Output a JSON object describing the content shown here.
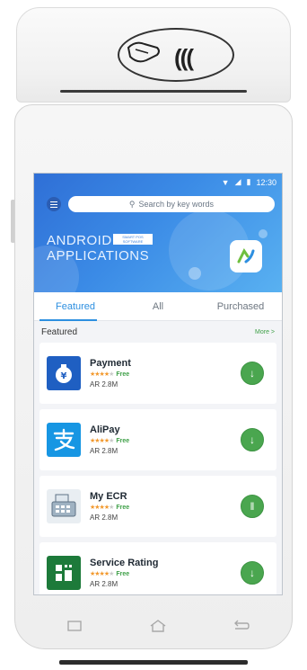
{
  "status_bar": {
    "time": "12:30"
  },
  "search": {
    "placeholder": "Search by key words"
  },
  "banner": {
    "title_line1": "ANDROID",
    "title_line2": "APPLICATIONS",
    "badge": "SMART POS SOFTWARE"
  },
  "tabs": [
    {
      "label": "Featured",
      "active": true
    },
    {
      "label": "All",
      "active": false
    },
    {
      "label": "Purchased",
      "active": false
    }
  ],
  "section": {
    "title": "Featured",
    "more_label": "More >"
  },
  "apps": [
    {
      "name": "Payment",
      "rating": 4,
      "price": "Free",
      "meta": "AR 2.8M",
      "icon": "payment-icon",
      "icon_color": "#1f5fc2"
    },
    {
      "name": "AliPay",
      "rating": 4,
      "price": "Free",
      "meta": "AR 2.8M",
      "icon": "alipay-icon",
      "icon_color": "#1796e3"
    },
    {
      "name": "My ECR",
      "rating": 4,
      "price": "Free",
      "meta": "AR 2.8M",
      "icon": "ecr-register-icon",
      "icon_color": "#8aa0b4"
    },
    {
      "name": "Service Rating",
      "rating": 4,
      "price": "Free",
      "meta": "AR 2.8M",
      "icon": "service-rating-icon",
      "icon_color": "#1d7a3a"
    }
  ],
  "colors": {
    "accent": "#2d8fe0",
    "download": "#4aa64f",
    "star": "#f2992e",
    "free": "#3fa048"
  }
}
